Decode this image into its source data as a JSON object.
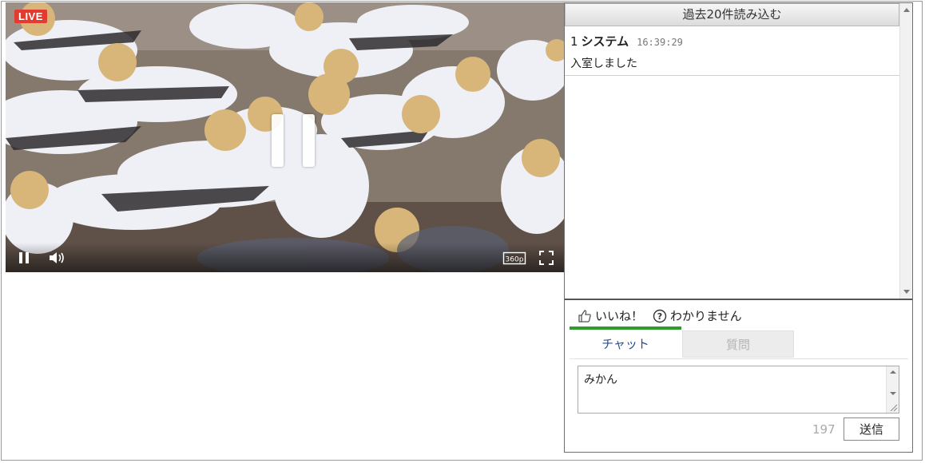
{
  "player": {
    "live_label": "LIVE",
    "quality_label": "360p",
    "icons": {
      "play_state": "pause-icon",
      "volume": "volume-icon",
      "quality": "quality-icon",
      "fullscreen": "fullscreen-icon"
    }
  },
  "chat": {
    "load_history_label": "過去20件読み込む",
    "messages": [
      {
        "number": "1",
        "user": "システム",
        "time": "16:39:29",
        "text": "入室しました"
      }
    ],
    "reactions": {
      "like_label": "いいね！",
      "dont_understand_label": "わかりません"
    },
    "tabs": [
      {
        "label": "チャット",
        "active": true
      },
      {
        "label": "質問",
        "active": false
      }
    ],
    "input_value": "みかん",
    "char_count": "197",
    "send_label": "送信"
  },
  "colors": {
    "live_badge": "#e33b2f",
    "active_tab_indicator": "#2e9b2e",
    "active_tab_text": "#2a4f8d",
    "inactive_tab_text": "#b4b4b4"
  }
}
